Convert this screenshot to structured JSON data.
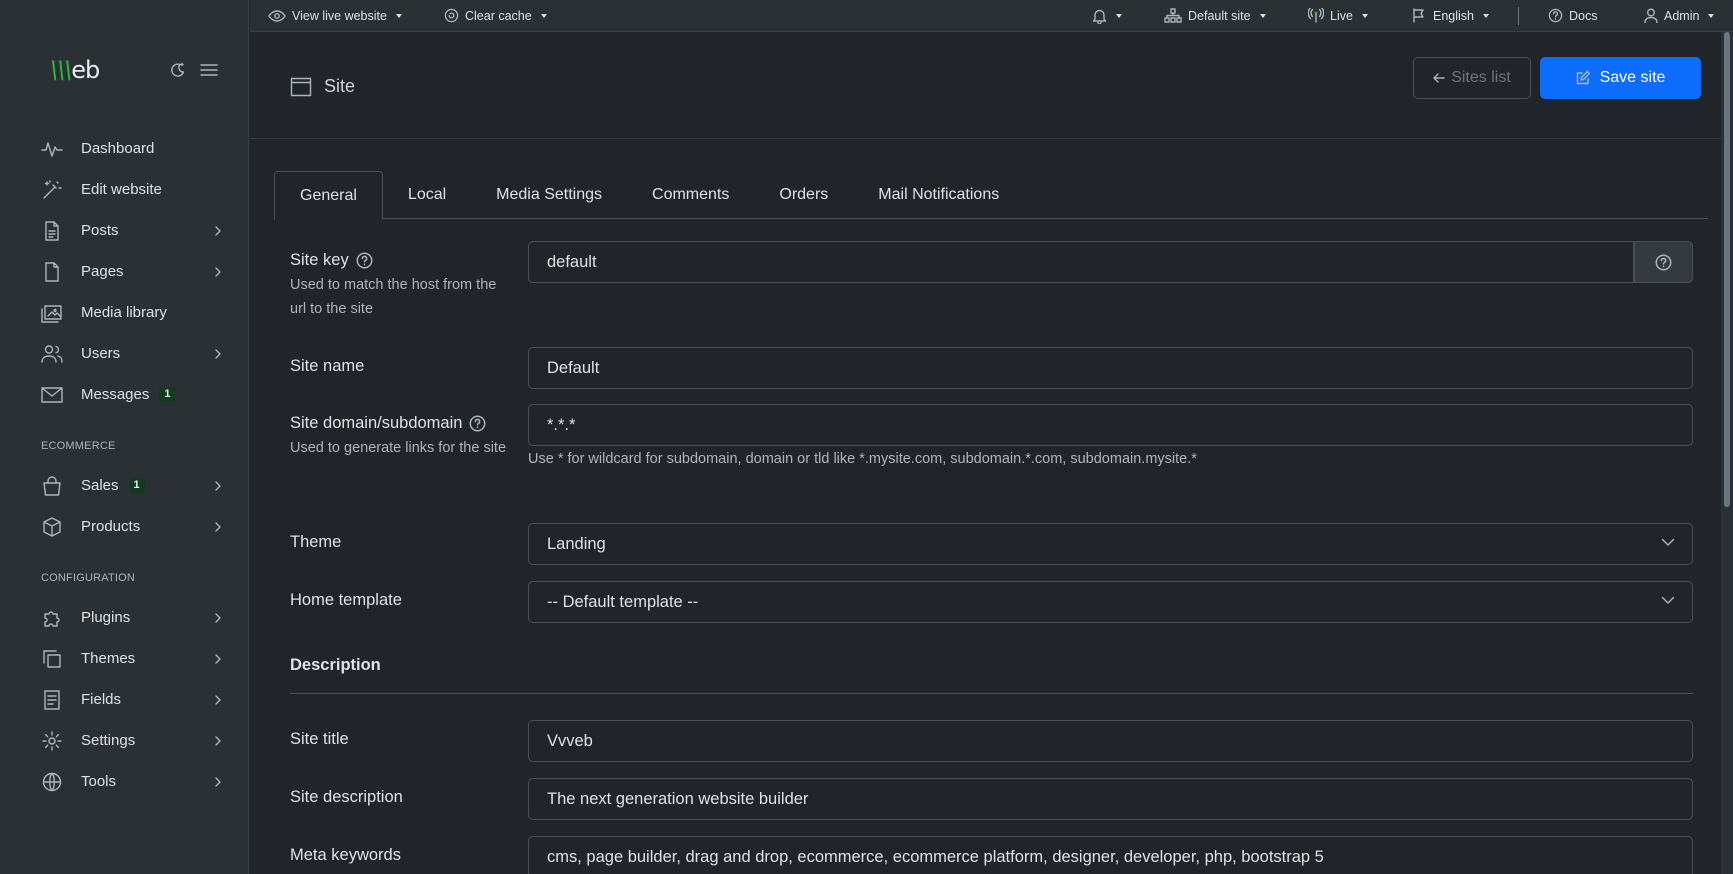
{
  "topbar": {
    "view_live": "View live website",
    "clear_cache": "Clear cache",
    "site": "Default site",
    "status": "Live",
    "language": "English",
    "docs": "Docs",
    "user": "Admin"
  },
  "sidebar": {
    "logo_v": "\\\\\\",
    "logo_text": "eb",
    "items": [
      {
        "label": "Dashboard",
        "icon": "pulse-icon"
      },
      {
        "label": "Edit website",
        "icon": "magic-wand-icon"
      },
      {
        "label": "Posts",
        "icon": "file-text-icon"
      },
      {
        "label": "Pages",
        "icon": "file-icon"
      },
      {
        "label": "Media library",
        "icon": "image-icon"
      },
      {
        "label": "Users",
        "icon": "users-icon"
      },
      {
        "label": "Messages",
        "icon": "mail-icon",
        "badge": "1"
      }
    ],
    "section_ecommerce": "ECOMMERCE",
    "ecommerce": [
      {
        "label": "Sales",
        "icon": "shopping-bag-icon",
        "badge": "1"
      },
      {
        "label": "Products",
        "icon": "box-icon"
      }
    ],
    "section_config": "CONFIGURATION",
    "config": [
      {
        "label": "Plugins",
        "icon": "puzzle-icon"
      },
      {
        "label": "Themes",
        "icon": "copy-icon"
      },
      {
        "label": "Fields",
        "icon": "list-icon"
      },
      {
        "label": "Settings",
        "icon": "gear-icon"
      },
      {
        "label": "Tools",
        "icon": "globe-icon"
      }
    ]
  },
  "header": {
    "title": "Site",
    "sites_list": "Sites list",
    "save": "Save site"
  },
  "tabs": [
    "General",
    "Local",
    "Media Settings",
    "Comments",
    "Orders",
    "Mail Notifications"
  ],
  "form": {
    "site_key": {
      "label": "Site key",
      "help": "Used to match the host from the url to the site",
      "value": "default"
    },
    "site_name": {
      "label": "Site name",
      "value": "Default"
    },
    "site_domain": {
      "label": "Site domain/subdomain",
      "help": "Used to generate links for the site",
      "value": "*.*.*",
      "hint": "Use * for wildcard for subdomain, domain or tld like *.mysite.com, subdomain.*.com, subdomain.mysite.*"
    },
    "theme": {
      "label": "Theme",
      "value": "Landing"
    },
    "home_template": {
      "label": "Home template",
      "value": "-- Default template --"
    },
    "description_title": "Description",
    "site_title": {
      "label": "Site title",
      "value": "Vvveb"
    },
    "site_description": {
      "label": "Site description",
      "value": "The next generation website builder"
    },
    "meta_keywords": {
      "label": "Meta keywords",
      "value": "cms, page builder, drag and drop, ecommerce, ecommerce platform, designer, developer, php, bootstrap 5"
    }
  },
  "colors": {
    "primary": "#0d6efd",
    "brand_green": "#2fb344",
    "background": "#212529",
    "sidebar": "#2b3035"
  }
}
